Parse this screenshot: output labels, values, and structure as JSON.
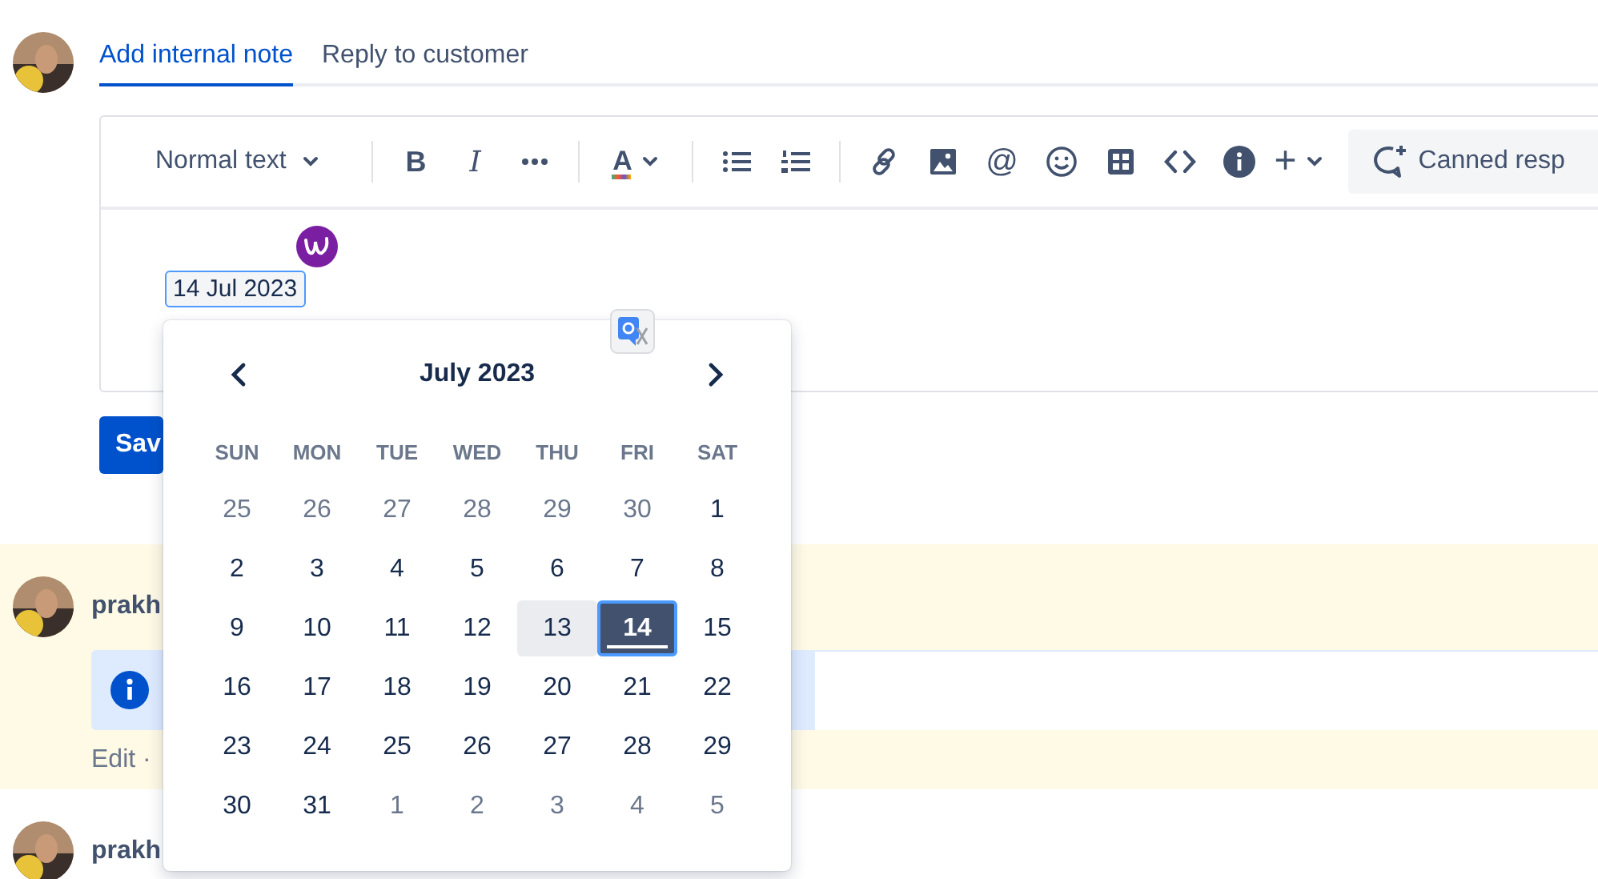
{
  "tabs": [
    {
      "label": "Add internal note",
      "selected": true
    },
    {
      "label": "Reply to customer",
      "selected": false
    }
  ],
  "toolbar": [
    {
      "kind": "dropdown",
      "label": "Normal text"
    },
    {
      "kind": "separator"
    },
    {
      "kind": "bold",
      "label": "B"
    },
    {
      "kind": "italic",
      "label": "I"
    },
    {
      "kind": "icon"
    },
    {
      "kind": "separator"
    },
    {
      "kind": "text-color",
      "label": "A"
    },
    {
      "kind": "separator"
    },
    {
      "kind": "icon"
    },
    {
      "kind": "icon"
    },
    {
      "kind": "separator"
    },
    {
      "kind": "icon"
    },
    {
      "kind": "icon"
    },
    {
      "kind": "mention",
      "label": "@"
    },
    {
      "kind": "icon"
    },
    {
      "kind": "icon"
    },
    {
      "kind": "icon"
    },
    {
      "kind": "icon"
    },
    {
      "kind": "insert",
      "label": "+"
    },
    {
      "kind": "canned",
      "label": "Canned resp"
    }
  ],
  "editor": {
    "date_chip": "14 Jul 2023"
  },
  "save_button": {
    "label": "Sav"
  },
  "date_picker": {
    "month": "July 2023",
    "weekdays": [
      "SUN",
      "MON",
      "TUE",
      "WED",
      "THU",
      "FRI",
      "SAT"
    ],
    "weeks": [
      [
        {
          "day": "25",
          "outside": true,
          "selected": false,
          "today": false,
          "hovered": false
        },
        {
          "day": "26",
          "outside": true,
          "selected": false,
          "today": false,
          "hovered": false
        },
        {
          "day": "27",
          "outside": true,
          "selected": false,
          "today": false,
          "hovered": false
        },
        {
          "day": "28",
          "outside": true,
          "selected": false,
          "today": false,
          "hovered": false
        },
        {
          "day": "29",
          "outside": true,
          "selected": false,
          "today": false,
          "hovered": false
        },
        {
          "day": "30",
          "outside": true,
          "selected": false,
          "today": false,
          "hovered": false
        },
        {
          "day": "1",
          "outside": false,
          "selected": false,
          "today": false,
          "hovered": false
        }
      ],
      [
        {
          "day": "2",
          "outside": false,
          "selected": false,
          "today": false,
          "hovered": false
        },
        {
          "day": "3",
          "outside": false,
          "selected": false,
          "today": false,
          "hovered": false
        },
        {
          "day": "4",
          "outside": false,
          "selected": false,
          "today": false,
          "hovered": false
        },
        {
          "day": "5",
          "outside": false,
          "selected": false,
          "today": false,
          "hovered": false
        },
        {
          "day": "6",
          "outside": false,
          "selected": false,
          "today": false,
          "hovered": false
        },
        {
          "day": "7",
          "outside": false,
          "selected": false,
          "today": false,
          "hovered": false
        },
        {
          "day": "8",
          "outside": false,
          "selected": false,
          "today": false,
          "hovered": false
        }
      ],
      [
        {
          "day": "9",
          "outside": false,
          "selected": false,
          "today": false,
          "hovered": false
        },
        {
          "day": "10",
          "outside": false,
          "selected": false,
          "today": false,
          "hovered": false
        },
        {
          "day": "11",
          "outside": false,
          "selected": false,
          "today": false,
          "hovered": false
        },
        {
          "day": "12",
          "outside": false,
          "selected": false,
          "today": false,
          "hovered": false
        },
        {
          "day": "13",
          "outside": false,
          "selected": false,
          "today": false,
          "hovered": true
        },
        {
          "day": "14",
          "outside": false,
          "selected": true,
          "today": true,
          "hovered": false
        },
        {
          "day": "15",
          "outside": false,
          "selected": false,
          "today": false,
          "hovered": false
        }
      ],
      [
        {
          "day": "16",
          "outside": false,
          "selected": false,
          "today": false,
          "hovered": false
        },
        {
          "day": "17",
          "outside": false,
          "selected": false,
          "today": false,
          "hovered": false
        },
        {
          "day": "18",
          "outside": false,
          "selected": false,
          "today": false,
          "hovered": false
        },
        {
          "day": "19",
          "outside": false,
          "selected": false,
          "today": false,
          "hovered": false
        },
        {
          "day": "20",
          "outside": false,
          "selected": false,
          "today": false,
          "hovered": false
        },
        {
          "day": "21",
          "outside": false,
          "selected": false,
          "today": false,
          "hovered": false
        },
        {
          "day": "22",
          "outside": false,
          "selected": false,
          "today": false,
          "hovered": false
        }
      ],
      [
        {
          "day": "23",
          "outside": false,
          "selected": false,
          "today": false,
          "hovered": false
        },
        {
          "day": "24",
          "outside": false,
          "selected": false,
          "today": false,
          "hovered": false
        },
        {
          "day": "25",
          "outside": false,
          "selected": false,
          "today": false,
          "hovered": false
        },
        {
          "day": "26",
          "outside": false,
          "selected": false,
          "today": false,
          "hovered": false
        },
        {
          "day": "27",
          "outside": false,
          "selected": false,
          "today": false,
          "hovered": false
        },
        {
          "day": "28",
          "outside": false,
          "selected": false,
          "today": false,
          "hovered": false
        },
        {
          "day": "29",
          "outside": false,
          "selected": false,
          "today": false,
          "hovered": false
        }
      ],
      [
        {
          "day": "30",
          "outside": false,
          "selected": false,
          "today": false,
          "hovered": false
        },
        {
          "day": "31",
          "outside": false,
          "selected": false,
          "today": false,
          "hovered": false
        },
        {
          "day": "1",
          "outside": true,
          "selected": false,
          "today": false,
          "hovered": false
        },
        {
          "day": "2",
          "outside": true,
          "selected": false,
          "today": false,
          "hovered": false
        },
        {
          "day": "3",
          "outside": true,
          "selected": false,
          "today": false,
          "hovered": false
        },
        {
          "day": "4",
          "outside": true,
          "selected": false,
          "today": false,
          "hovered": false
        },
        {
          "day": "5",
          "outside": true,
          "selected": false,
          "today": false,
          "hovered": false
        }
      ]
    ]
  },
  "comments": [
    {
      "author": "prakh",
      "highlighted": true,
      "panel": {
        "kind": "info"
      },
      "footer": "Edit ·"
    },
    {
      "author": "prakh",
      "highlighted": false
    }
  ]
}
